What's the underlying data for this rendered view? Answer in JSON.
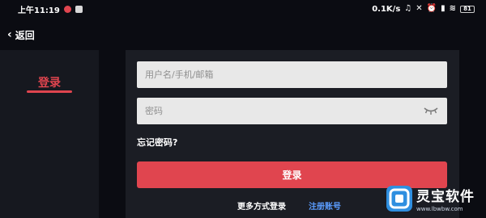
{
  "status_bar": {
    "time": "上午11:19",
    "net_speed": "0.1K/s",
    "battery": "81"
  },
  "nav": {
    "back_label": "返回"
  },
  "sidebar": {
    "tab_login": "登录"
  },
  "form": {
    "username_placeholder": "用户名/手机/邮箱",
    "password_placeholder": "密码",
    "forgot_password": "忘记密码?",
    "login_button": "登录",
    "more_login": "更多方式登录",
    "register": "注册账号"
  },
  "colors": {
    "accent": "#e0454f",
    "link": "#5b9dff",
    "background": "#0b0c12",
    "card": "#1b1d24"
  },
  "watermark": {
    "title": "灵宝软件",
    "url": "www.lbwbw.com"
  },
  "icons": [
    "chevron-left-icon",
    "eye-closed-icon",
    "wifi-icon",
    "signal-icon",
    "battery-icon"
  ]
}
